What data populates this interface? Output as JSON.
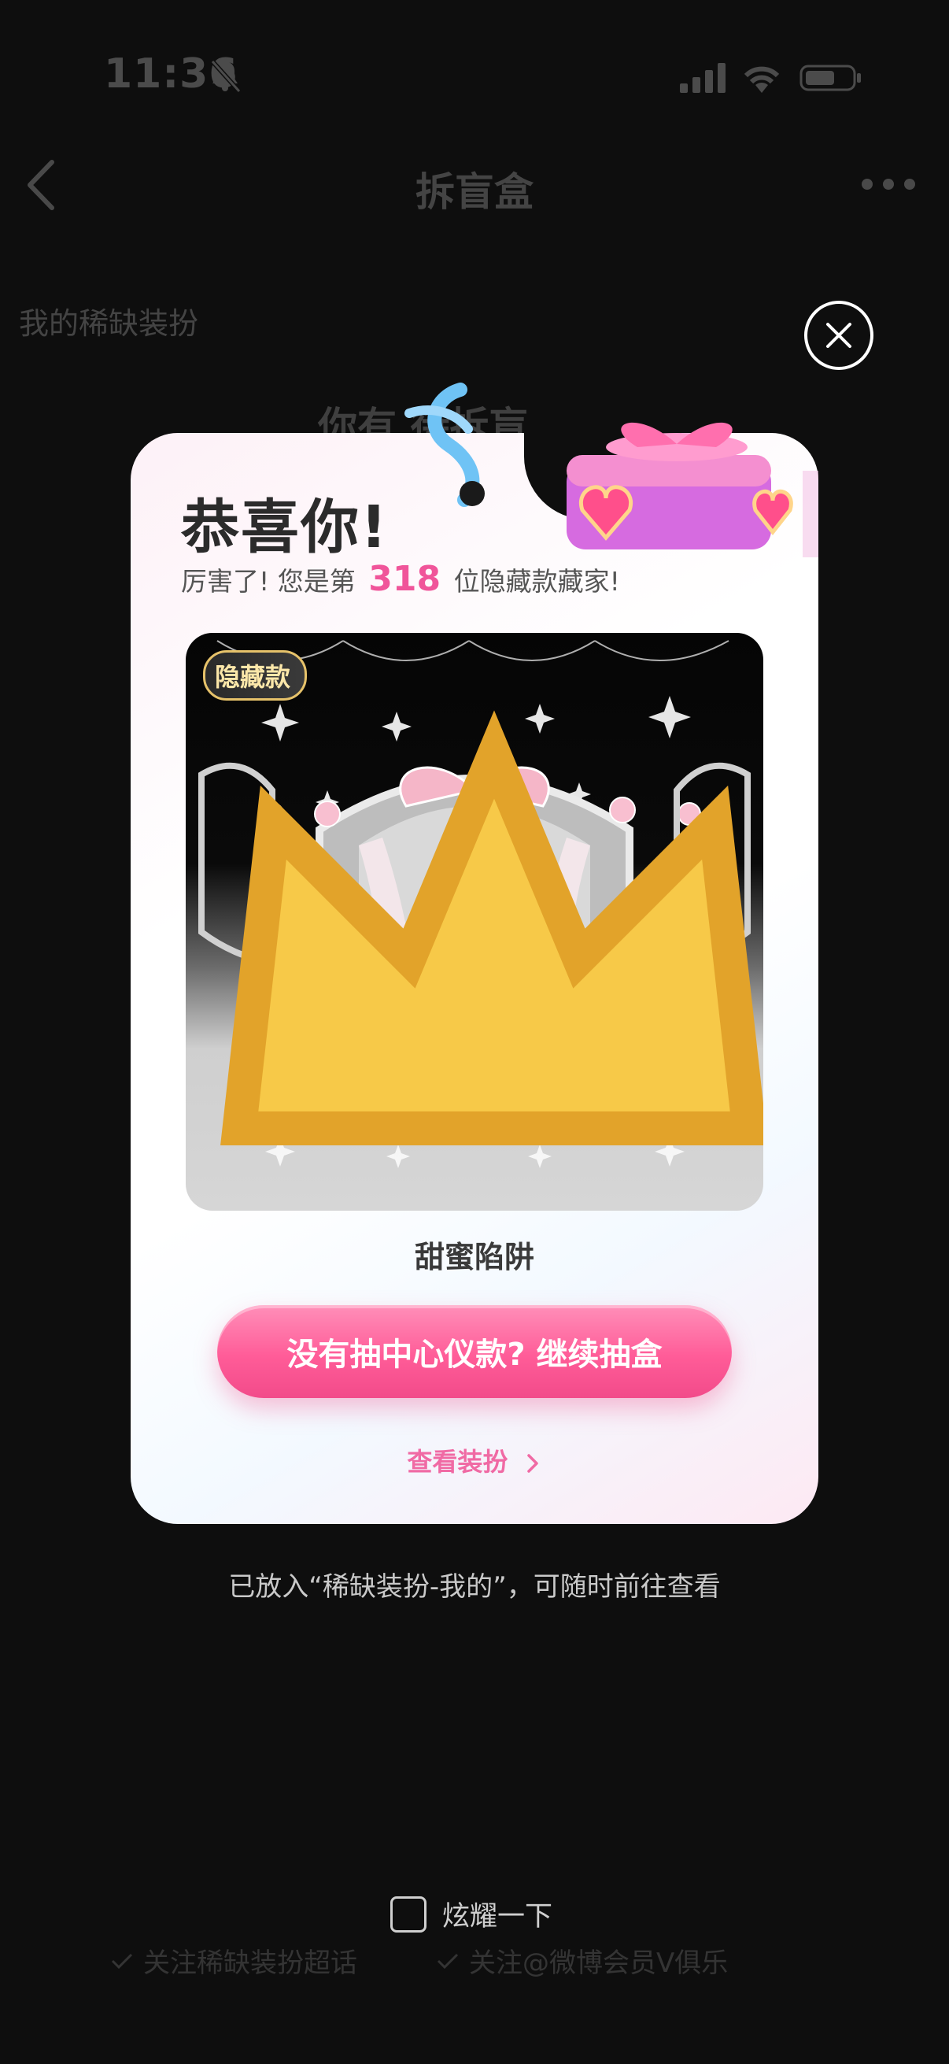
{
  "status_bar": {
    "time": "11:36"
  },
  "header": {
    "title": "拆盲盒"
  },
  "background": {
    "section_label": "我的稀缺装扮",
    "heading": "你有  待拆盲"
  },
  "modal": {
    "title": "恭喜你!",
    "subtitle_prefix": "厉害了!  您是第",
    "rank": "318",
    "subtitle_suffix": "位隐藏款藏家!",
    "badge_label": "隐藏款",
    "item_name": "甜蜜陷阱",
    "primary_button": "没有抽中心仪款? 继续抽盒",
    "view_link": "查看装扮",
    "accent_color": "#f0559a"
  },
  "footer": {
    "note": "已放入“稀缺装扮-我的”，可随时前往查看",
    "share_label": "炫耀一下",
    "share_checked": false,
    "follow_options": [
      {
        "label": "关注稀缺装扮超话"
      },
      {
        "label": "关注@微博会员V俱乐"
      }
    ]
  },
  "icons": [
    "bell-off-icon",
    "signal-icon",
    "wifi-icon",
    "battery-icon",
    "back-icon",
    "more-icon",
    "close-icon",
    "crown-icon",
    "chevron-right-icon",
    "checkbox-icon",
    "check-icon"
  ]
}
